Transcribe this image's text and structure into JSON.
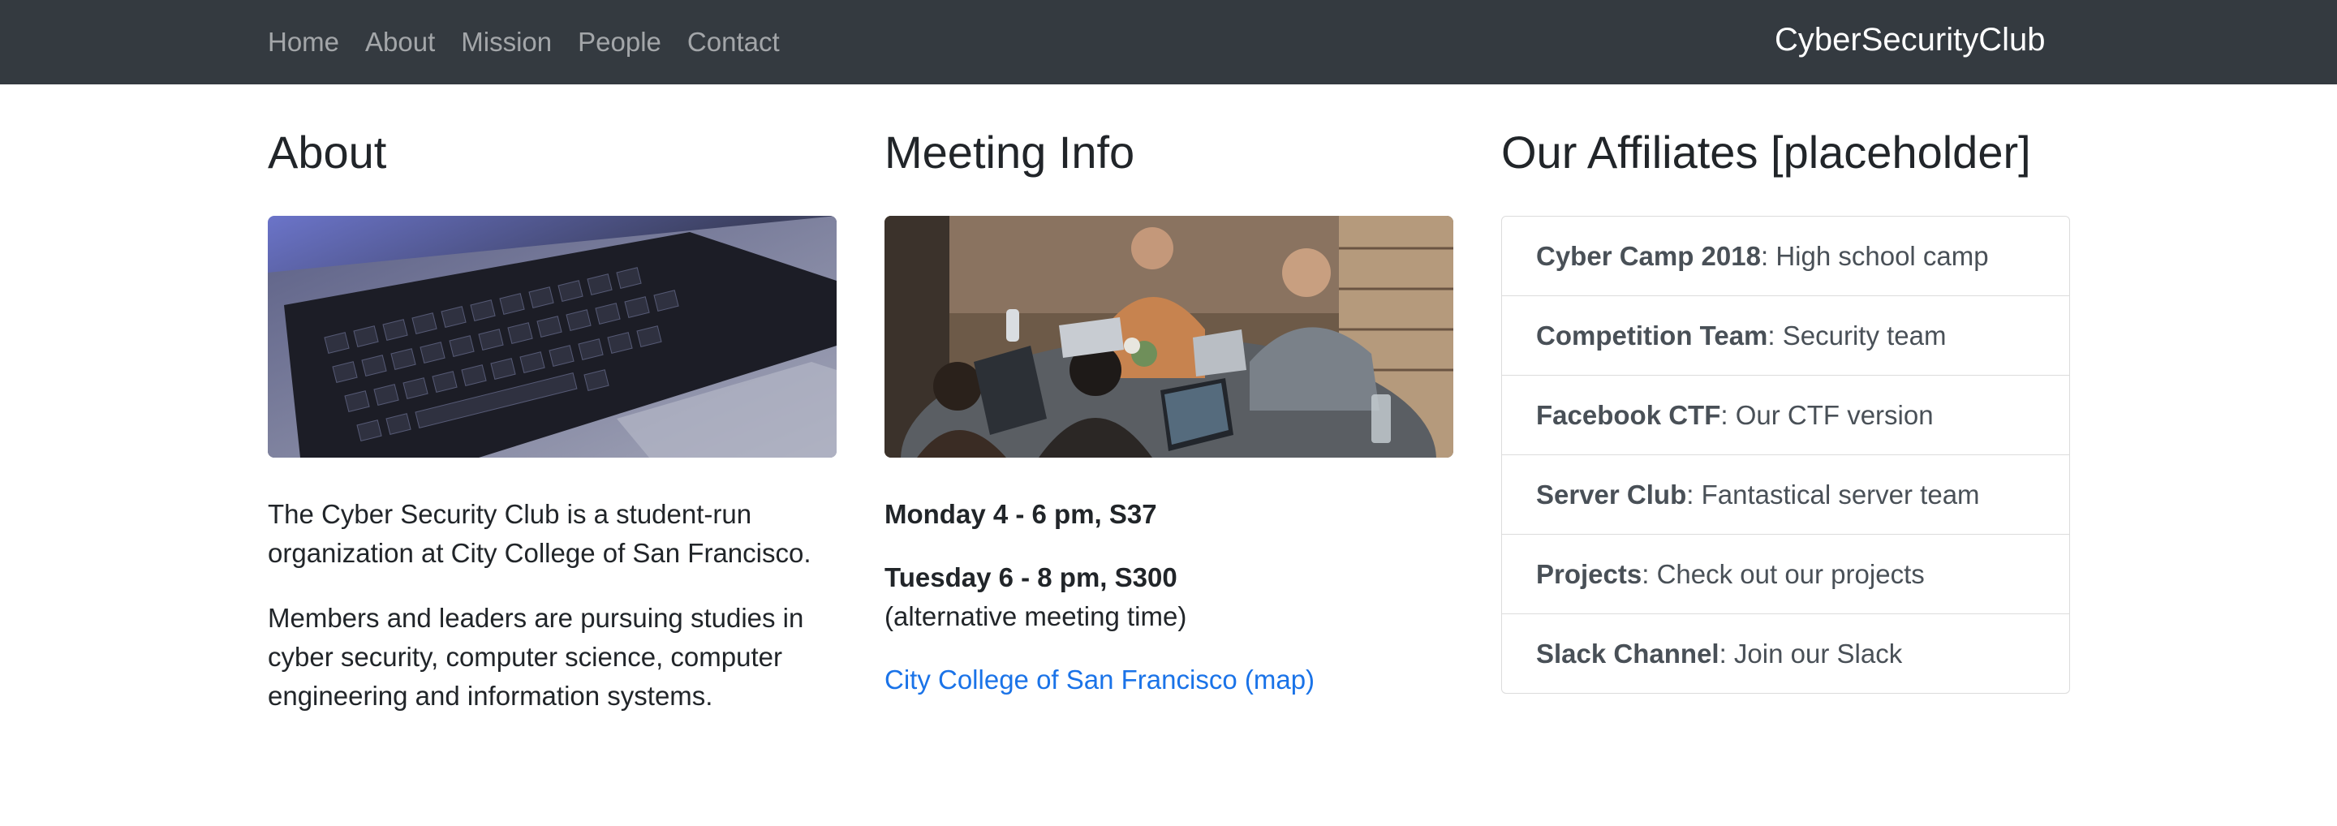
{
  "nav": {
    "links": [
      "Home",
      "About",
      "Mission",
      "People",
      "Contact"
    ],
    "brand": "CyberSecurityClub"
  },
  "about": {
    "title": "About",
    "image": "laptop-keyboard-photo",
    "p1": "The Cyber Security Club is a student-run organization at City College of San Francisco.",
    "p2": "Members and leaders are pursuing studies in cyber security, computer science, computer engineering and information systems."
  },
  "meeting": {
    "title": "Meeting Info",
    "image": "students-with-laptops-photo",
    "monday": "Monday 4 - 6 pm, S37",
    "tuesday": "Tuesday 6 - 8 pm, S300",
    "tuesday_note": "(alternative meeting time)",
    "map_link": "City College of San Francisco (map)"
  },
  "affiliates": {
    "title": "Our Affiliates [placeholder]",
    "items": [
      {
        "name": "Cyber Camp 2018",
        "desc": ": High school camp"
      },
      {
        "name": "Competition Team",
        "desc": ": Security team"
      },
      {
        "name": "Facebook CTF",
        "desc": ": Our CTF version"
      },
      {
        "name": "Server Club",
        "desc": ": Fantastical server team"
      },
      {
        "name": "Projects",
        "desc": ": Check out our projects"
      },
      {
        "name": "Slack Channel",
        "desc": ": Join our Slack"
      }
    ]
  },
  "colors": {
    "navbar_bg": "#343a40",
    "link": "#1a73e8",
    "text": "#212529"
  }
}
